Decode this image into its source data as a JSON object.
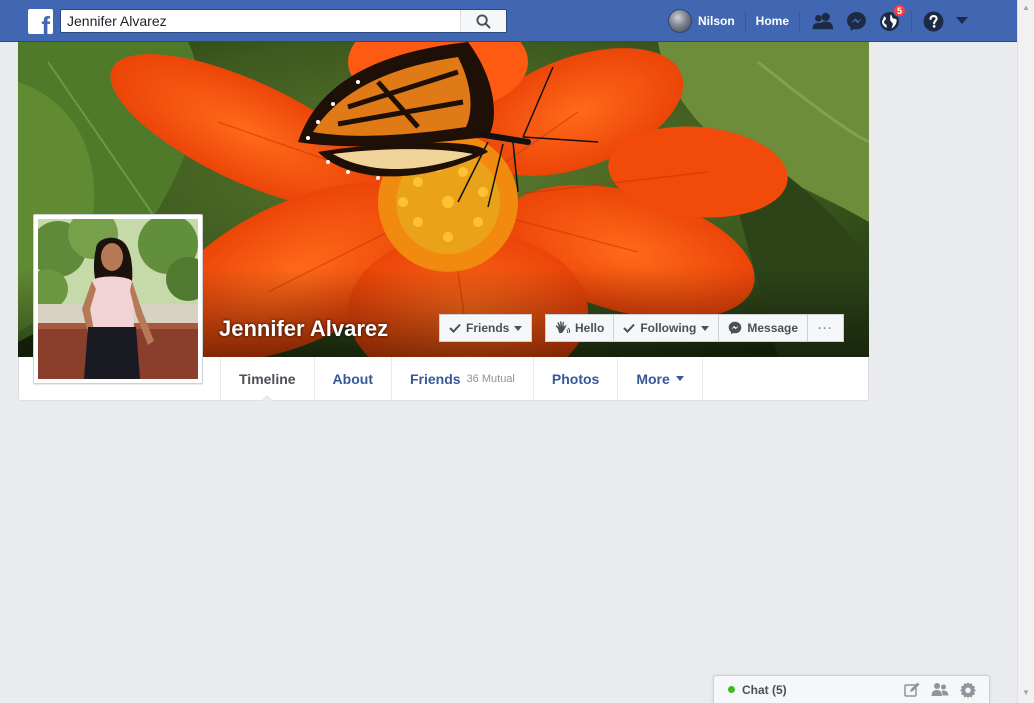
{
  "header": {
    "search_value": "Jennifer Alvarez",
    "user_name": "Nilson",
    "home_label": "Home",
    "notification_count": "5"
  },
  "profile": {
    "name": "Jennifer Alvarez"
  },
  "actions": {
    "friends_label": "Friends",
    "hello_label": "Hello",
    "following_label": "Following",
    "message_label": "Message",
    "more_label": "···"
  },
  "tabs": [
    {
      "label": "Timeline",
      "active": true
    },
    {
      "label": "About"
    },
    {
      "label": "Friends",
      "sub": "36 Mutual"
    },
    {
      "label": "Photos"
    },
    {
      "label": "More"
    }
  ],
  "chat": {
    "label": "Chat (5)"
  },
  "colors": {
    "brand_blue": "#4267b2",
    "link_blue": "#365899",
    "online_green": "#42b72a",
    "badge_red": "#fa3e3e"
  }
}
